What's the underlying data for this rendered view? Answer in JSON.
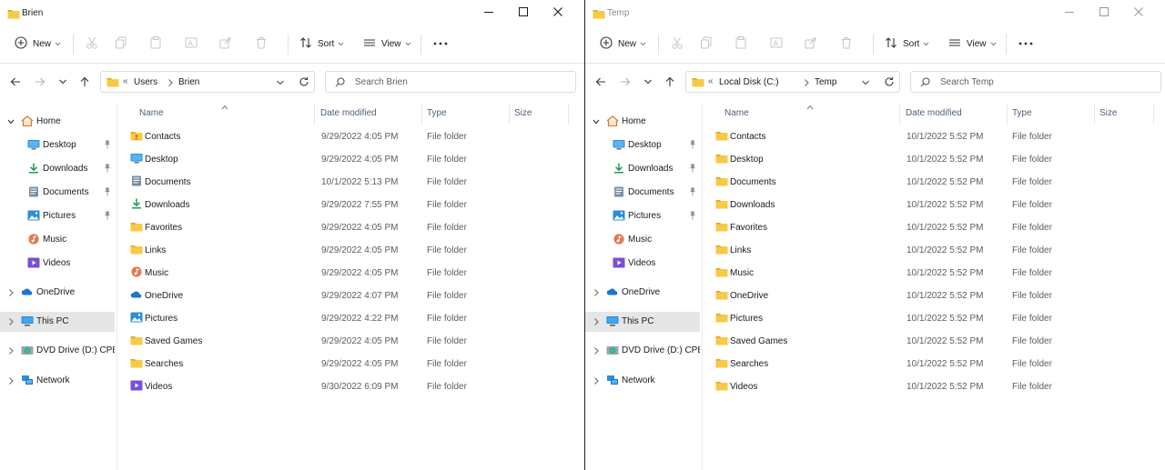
{
  "colors": {
    "folder": "#f8c945",
    "accent": "#0a66c2",
    "selection": "#e6e6e6"
  },
  "windows": [
    {
      "title": "Brien",
      "toolbar": {
        "new_label": "New",
        "sort_label": "Sort",
        "view_label": "View"
      },
      "breadcrumb": {
        "overflow": "«",
        "segments": [
          "Users",
          "Brien"
        ]
      },
      "search_placeholder": "Search Brien",
      "nav": [
        "Home",
        "Desktop",
        "Downloads",
        "Documents",
        "Pictures",
        "Music",
        "Videos",
        "OneDrive",
        "This PC",
        "DVD Drive (D:) CPBA",
        "Network"
      ],
      "columns": {
        "name": "Name",
        "date": "Date modified",
        "type": "Type",
        "size": "Size"
      },
      "rows": [
        {
          "icon": "contacts-folder-icon",
          "name": "Contacts",
          "date": "9/29/2022 4:05 PM",
          "type": "File folder"
        },
        {
          "icon": "desktop-icon",
          "name": "Desktop",
          "date": "9/29/2022 4:05 PM",
          "type": "File folder"
        },
        {
          "icon": "documents-icon",
          "name": "Documents",
          "date": "10/1/2022 5:13 PM",
          "type": "File folder"
        },
        {
          "icon": "download-icon",
          "name": "Downloads",
          "date": "9/29/2022 7:55 PM",
          "type": "File folder"
        },
        {
          "icon": "folder-icon",
          "name": "Favorites",
          "date": "9/29/2022 4:05 PM",
          "type": "File folder"
        },
        {
          "icon": "folder-icon",
          "name": "Links",
          "date": "9/29/2022 4:05 PM",
          "type": "File folder"
        },
        {
          "icon": "music-icon",
          "name": "Music",
          "date": "9/29/2022 4:05 PM",
          "type": "File folder"
        },
        {
          "icon": "onedrive-icon",
          "name": "OneDrive",
          "date": "9/29/2022 4:07 PM",
          "type": "File folder"
        },
        {
          "icon": "pictures-icon",
          "name": "Pictures",
          "date": "9/29/2022 4:22 PM",
          "type": "File folder"
        },
        {
          "icon": "folder-icon",
          "name": "Saved Games",
          "date": "9/29/2022 4:05 PM",
          "type": "File folder"
        },
        {
          "icon": "folder-icon",
          "name": "Searches",
          "date": "9/29/2022 4:05 PM",
          "type": "File folder"
        },
        {
          "icon": "videos-icon",
          "name": "Videos",
          "date": "9/30/2022 6:09 PM",
          "type": "File folder"
        }
      ]
    },
    {
      "title": "Temp",
      "toolbar": {
        "new_label": "New",
        "sort_label": "Sort",
        "view_label": "View"
      },
      "breadcrumb": {
        "overflow": "«",
        "segments": [
          "Local Disk (C:)",
          "Temp"
        ]
      },
      "search_placeholder": "Search Temp",
      "nav": [
        "Home",
        "Desktop",
        "Downloads",
        "Documents",
        "Pictures",
        "Music",
        "Videos",
        "OneDrive",
        "This PC",
        "DVD Drive (D:) CPBA",
        "Network"
      ],
      "columns": {
        "name": "Name",
        "date": "Date modified",
        "type": "Type",
        "size": "Size"
      },
      "rows": [
        {
          "icon": "folder-icon",
          "name": "Contacts",
          "date": "10/1/2022 5:52 PM",
          "type": "File folder"
        },
        {
          "icon": "folder-icon",
          "name": "Desktop",
          "date": "10/1/2022 5:52 PM",
          "type": "File folder"
        },
        {
          "icon": "folder-icon",
          "name": "Documents",
          "date": "10/1/2022 5:52 PM",
          "type": "File folder"
        },
        {
          "icon": "folder-icon",
          "name": "Downloads",
          "date": "10/1/2022 5:52 PM",
          "type": "File folder"
        },
        {
          "icon": "folder-icon",
          "name": "Favorites",
          "date": "10/1/2022 5:52 PM",
          "type": "File folder"
        },
        {
          "icon": "folder-icon",
          "name": "Links",
          "date": "10/1/2022 5:52 PM",
          "type": "File folder"
        },
        {
          "icon": "folder-icon",
          "name": "Music",
          "date": "10/1/2022 5:52 PM",
          "type": "File folder"
        },
        {
          "icon": "folder-icon",
          "name": "OneDrive",
          "date": "10/1/2022 5:52 PM",
          "type": "File folder"
        },
        {
          "icon": "folder-icon",
          "name": "Pictures",
          "date": "10/1/2022 5:52 PM",
          "type": "File folder"
        },
        {
          "icon": "folder-icon",
          "name": "Saved Games",
          "date": "10/1/2022 5:52 PM",
          "type": "File folder"
        },
        {
          "icon": "folder-icon",
          "name": "Searches",
          "date": "10/1/2022 5:52 PM",
          "type": "File folder"
        },
        {
          "icon": "folder-icon",
          "name": "Videos",
          "date": "10/1/2022 5:52 PM",
          "type": "File folder"
        }
      ]
    }
  ]
}
